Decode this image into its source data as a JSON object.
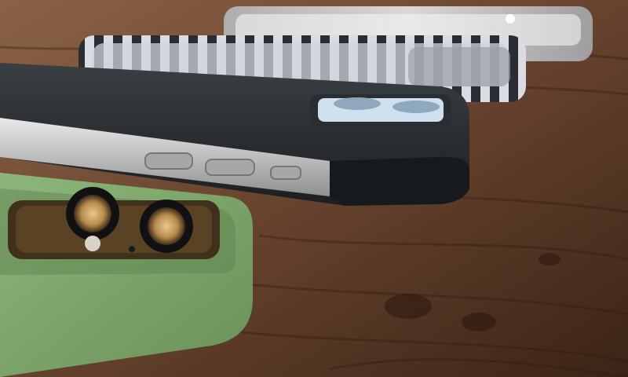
{
  "scene": {
    "subjects": [
      "wooden-table",
      "clear-case-back",
      "striped-bumper-case",
      "black-case-phone",
      "green-silicone-case"
    ],
    "colors": {
      "wood_dark": "#2e1b10",
      "wood_mid": "#6b4630",
      "wood_light": "#a07a5c",
      "steel": "#c8c8c8",
      "case_black": "#1e2226",
      "case_green": "#7fa46a",
      "clear_case": "#d8dbe0",
      "lens_gold": "#c9a161"
    }
  }
}
